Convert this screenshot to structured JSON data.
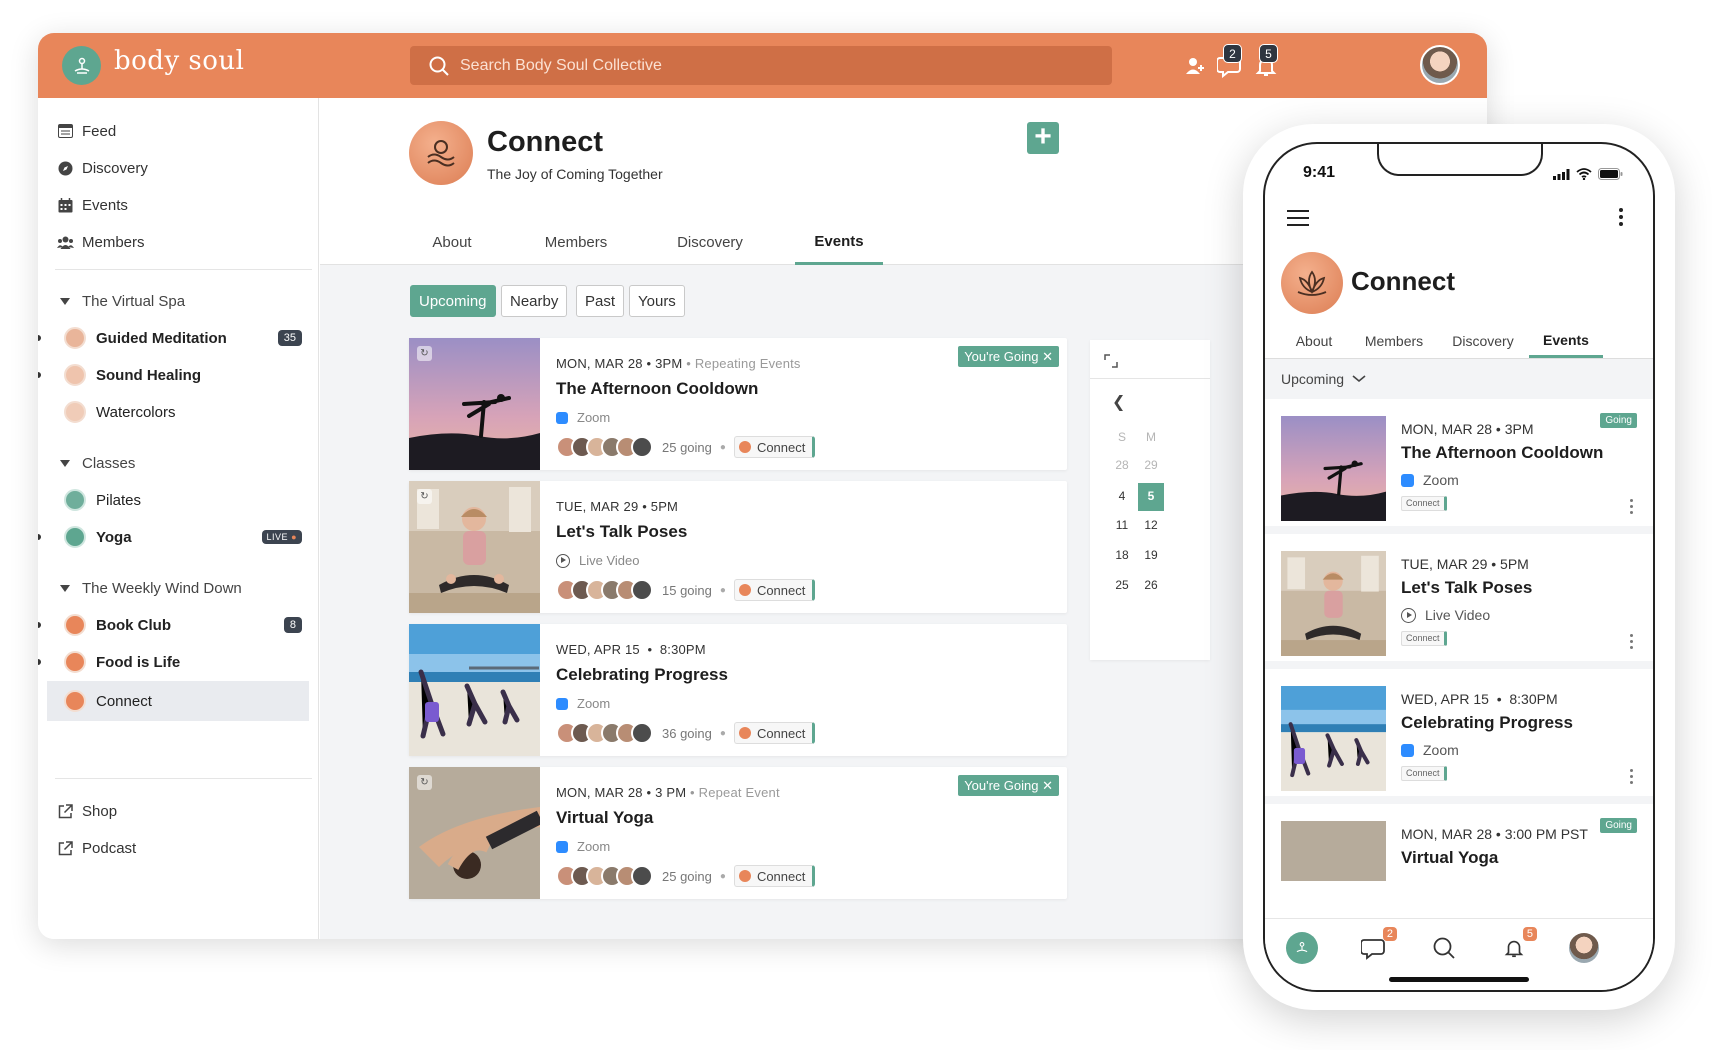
{
  "app": {
    "logo_text": "body soul",
    "search_placeholder": "Search Body Soul Collective",
    "badges": {
      "chat": "2",
      "notifications": "5"
    }
  },
  "sidebar": {
    "nav": [
      {
        "label": "Feed",
        "icon": "feed-icon"
      },
      {
        "label": "Discovery",
        "icon": "compass-icon"
      },
      {
        "label": "Events",
        "icon": "calendar-icon"
      },
      {
        "label": "Members",
        "icon": "members-icon"
      }
    ],
    "groups": [
      {
        "label": "The Virtual Spa",
        "items": [
          {
            "label": "Guided Meditation",
            "count": "35",
            "bold": true
          },
          {
            "label": "Sound Healing",
            "bold": true
          },
          {
            "label": "Watercolors",
            "bold": false
          }
        ]
      },
      {
        "label": "Classes",
        "items": [
          {
            "label": "Pilates",
            "bold": false
          },
          {
            "label": "Yoga",
            "live": "LIVE",
            "bold": true
          }
        ]
      },
      {
        "label": "The Weekly Wind Down",
        "items": [
          {
            "label": "Book Club",
            "count": "8",
            "bold": true
          },
          {
            "label": "Food is Life",
            "bold": true
          },
          {
            "label": "Connect",
            "bold": false,
            "active": true
          }
        ]
      }
    ],
    "footer": [
      {
        "label": "Shop",
        "icon": "external-link-icon"
      },
      {
        "label": "Podcast",
        "icon": "external-link-icon"
      }
    ]
  },
  "group": {
    "title": "Connect",
    "subtitle": "The Joy of Coming Together",
    "tabs": [
      "About",
      "Members",
      "Discovery",
      "Events"
    ],
    "active_tab": "Events"
  },
  "filters": [
    "Upcoming",
    "Nearby",
    "Past",
    "Yours"
  ],
  "events": [
    {
      "date": "MON, MAR 28 • 3PM",
      "date_note": "Repeating Events",
      "title": "The Afternoon Cooldown",
      "location": "Zoom",
      "going": "25 going",
      "group": "Connect",
      "tag": "You're Going",
      "repeat": true
    },
    {
      "date": "TUE, MAR 29 • 5PM",
      "date_note": "",
      "title": "Let's Talk Poses",
      "location": "Live Video",
      "going": "15 going",
      "group": "Connect",
      "tag": "",
      "repeat": true
    },
    {
      "date": "WED, APR 15  •  8:30PM",
      "date_note": "",
      "title": "Celebrating Progress",
      "location": "Zoom",
      "going": "36 going",
      "group": "Connect",
      "tag": "",
      "repeat": false
    },
    {
      "date": "MON, MAR 28 • 3 PM",
      "date_note": "Repeat Event",
      "title": "Virtual Yoga",
      "location": "Zoom",
      "going": "25 going",
      "group": "Connect",
      "tag": "You're Going",
      "repeat": true
    }
  ],
  "calendar": {
    "prev": "❮",
    "headers": [
      "S",
      "M"
    ],
    "rows": [
      [
        "28",
        "29"
      ],
      [
        "4",
        "5"
      ],
      [
        "11",
        "12"
      ],
      [
        "18",
        "19"
      ],
      [
        "25",
        "26"
      ]
    ],
    "selected": "5"
  },
  "phone": {
    "time": "9:41",
    "title": "Connect",
    "tabs": [
      "About",
      "Members",
      "Discovery",
      "Events"
    ],
    "filter": "Upcoming",
    "events": [
      {
        "date": "MON, MAR 28 • 3PM",
        "title": "The Afternoon Cooldown",
        "location": "Zoom",
        "group": "Connect",
        "tag": "Going"
      },
      {
        "date": "TUE, MAR 29 • 5PM",
        "title": "Let's Talk Poses",
        "location": "Live Video",
        "group": "Connect",
        "tag": ""
      },
      {
        "date": "WED, APR 15  •  8:30PM",
        "title": "Celebrating Progress",
        "location": "Zoom",
        "group": "Connect",
        "tag": ""
      },
      {
        "date": "MON, MAR 28 • 3:00 PM PST",
        "title": "Virtual Yoga",
        "location": "",
        "group": "",
        "tag": "Going"
      }
    ],
    "nav_badges": {
      "chat": "2",
      "notifications": "5"
    }
  },
  "colors": {
    "brand_orange": "#e8865a",
    "accent_green": "#5ea690",
    "dark": "#2f3640"
  }
}
